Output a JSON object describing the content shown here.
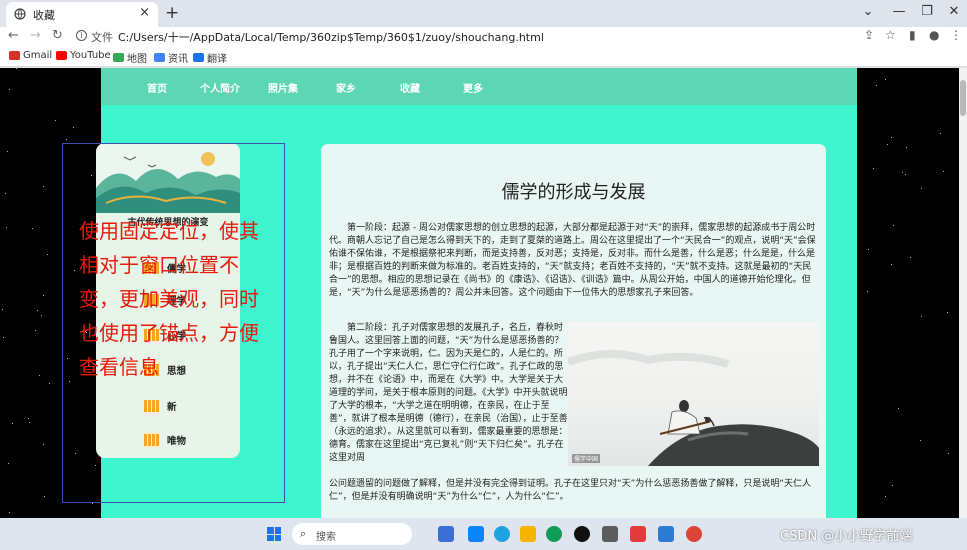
{
  "browser": {
    "tab_title": "收藏",
    "tab_close": "×",
    "new_tab": "+",
    "win_buttons": [
      "⌄",
      "—",
      "❐",
      "✕"
    ],
    "address_prefix": "文件",
    "address_url": "C:/Users/十一/AppData/Local/Temp/360zip$Temp/360$1/zuoy/shouchang.html",
    "bookmarks": [
      "Gmail",
      "YouTube",
      "地图",
      "资讯",
      "翻译"
    ],
    "bookmark_colors": [
      "#d93025",
      "#ff0000",
      "#34a853",
      "#4285f4",
      "#1a73e8"
    ]
  },
  "nav": {
    "items": [
      "首页",
      "个人简介",
      "照片集",
      "家乡",
      "收藏",
      "更多"
    ]
  },
  "sidebar": {
    "title": "古代传统思想的演变",
    "items": [
      "儒学",
      "理学",
      "心学",
      "思想",
      "新",
      "唯物"
    ]
  },
  "annotation": {
    "text": "使用固定定位，使其相对于窗口位置不变，更加美观，同时也使用了锚点，方便查看信息"
  },
  "article": {
    "title": "儒学的形成与发展",
    "paragraph1": "第一阶段：起源 - 周公对儒家思想的创立思想的起源，大部分都是起源于对“天”的崇拜，儒家思想的起源成书于周公时代。商朝人忘记了自己是怎么得到天下的，走到了夏桀的道路上。周公在这里提出了一个“天民合一”的观点，说明“天”会保佑谁不保佑谁，不是根据祭祀来判断，而是支持善，反对恶；支持是，反对非。而什么是善，什么是恶；什么是是，什么是非；是根据百姓的判断来做为标准的。老百姓支持的，“天”就支持；老百姓不支持的，“天”就不支持。这就是最初的“天民合一”的思想。相应的思想记录在《尚书》的《康诰》、《诏诰》、《训诰》篇中。从周公开始，中国人的道德开始伦理化。但是，“天”为什么是惩恶扬善的？周公并未回答。这个问题由下一位伟大的思想家孔子来回答。",
    "paragraph2": "第二阶段：孔子对儒家思想的发展孔子，名丘，春秋时鲁国人。这里回答上面的问题，“天”为什么是惩恶扬善的？孔子用了一个字来说明，仁。因为天是仁的，人是仁的。所以，孔子提出“天仁人仁，思仁守仁行仁政”。孔子仁政的思想，并不在《论语》中，而是在《大学》中。大学是关于大道理的学问，是关于根本原则的问题。《大学》中开头就说明了大学的根本，“大学之道在明明德，在亲民，在止于至善”，就讲了根本是明德（德行），在亲民（治国），止于至善（永远的追求）。从这里就可以看到，儒家最重要的思想是：德育。儒家在这里提出“克已复礼”则“天下归仁矣”。孔子在这里对周",
    "paragraph2_tail": "公问题遗留的问题做了解释，但是并没有完全得到证明。孔子在这里只对“天”为什么惩恶扬善做了解释，只是说明“天仁人仁”，但是并没有明确说明“天”为什么“仁”，人为什么“仁”。",
    "image_caption": "儒学中国"
  },
  "taskbar": {
    "search_placeholder": "搜索",
    "watermark": "CSDN @小小野学前端",
    "app_colors": [
      "#3b6fd4",
      "#e9ecf2",
      "#0a84ff",
      "#f4b400",
      "#0f9d58",
      "#111111",
      "#e23b3b",
      "#2b7cd3",
      "#db4437"
    ]
  }
}
